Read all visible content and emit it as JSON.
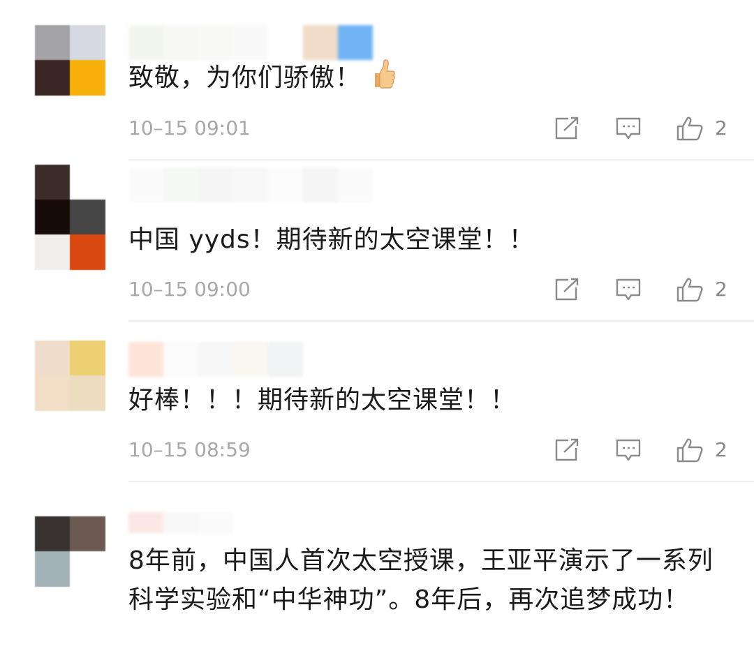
{
  "comments": [
    {
      "text": "致敬，为你们骄傲！",
      "emoji": "thumbs-up",
      "timestamp": "10–15 09:01",
      "likes": "2"
    },
    {
      "text": "中国 yyds！期待新的太空课堂！！",
      "timestamp": "10–15 09:00",
      "likes": "2"
    },
    {
      "text": "好棒！！！期待新的太空课堂！！",
      "timestamp": "10–15 08:59",
      "likes": "2"
    },
    {
      "text": "8年前，中国人首次太空授课，王亚平演示了一系列科学实验和“中华神功”。8年后，再次追梦成功！"
    }
  ],
  "icons": {
    "share": "share-icon",
    "reply": "reply-icon",
    "like": "thumbs-up-icon"
  },
  "colors": {
    "text": "#1a1a1a",
    "meta": "#a8a8a8",
    "icon": "#8a8a8a",
    "divider": "#efefef"
  }
}
